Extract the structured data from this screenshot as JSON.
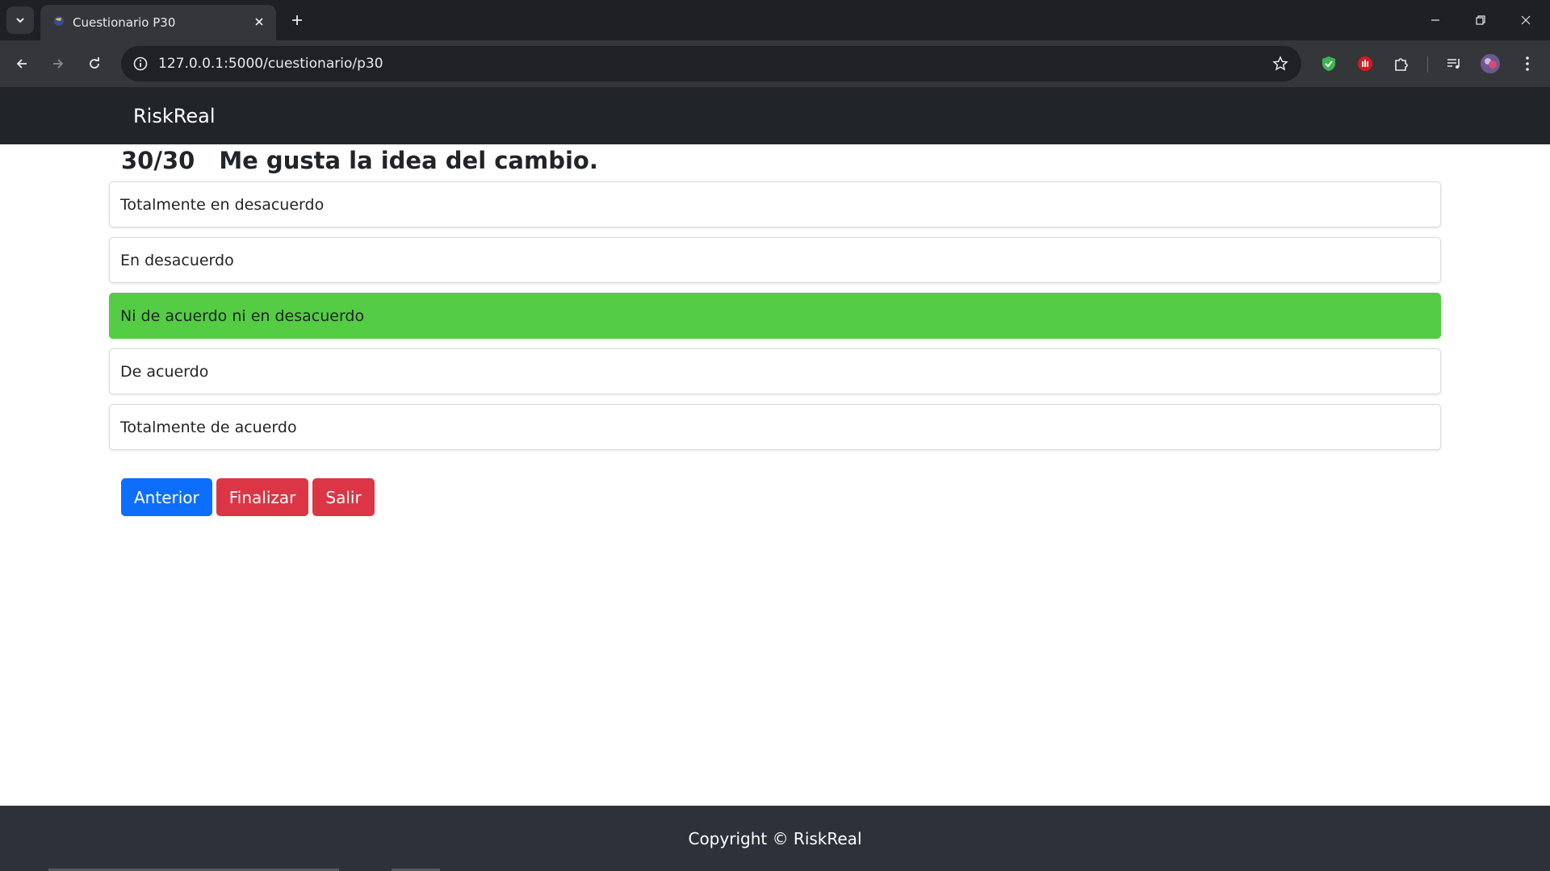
{
  "browser": {
    "tab_title": "Cuestionario P30",
    "url": "127.0.0.1:5000/cuestionario/p30"
  },
  "navbar": {
    "brand": "RiskReal"
  },
  "question": {
    "number": "30/30",
    "text": "Me gusta la idea del cambio."
  },
  "options": [
    {
      "label": "Totalmente en desacuerdo",
      "selected": false
    },
    {
      "label": "En desacuerdo",
      "selected": false
    },
    {
      "label": "Ni de acuerdo ni en desacuerdo",
      "selected": true
    },
    {
      "label": "De acuerdo",
      "selected": false
    },
    {
      "label": "Totalmente de acuerdo",
      "selected": false
    }
  ],
  "buttons": {
    "previous": "Anterior",
    "finish": "Finalizar",
    "exit": "Salir"
  },
  "footer": {
    "copyright": "Copyright © RiskReal"
  },
  "colors": {
    "selected_option": "#54cc43",
    "primary": "#0d6efd",
    "danger": "#dc3545",
    "navbar": "#212529"
  }
}
